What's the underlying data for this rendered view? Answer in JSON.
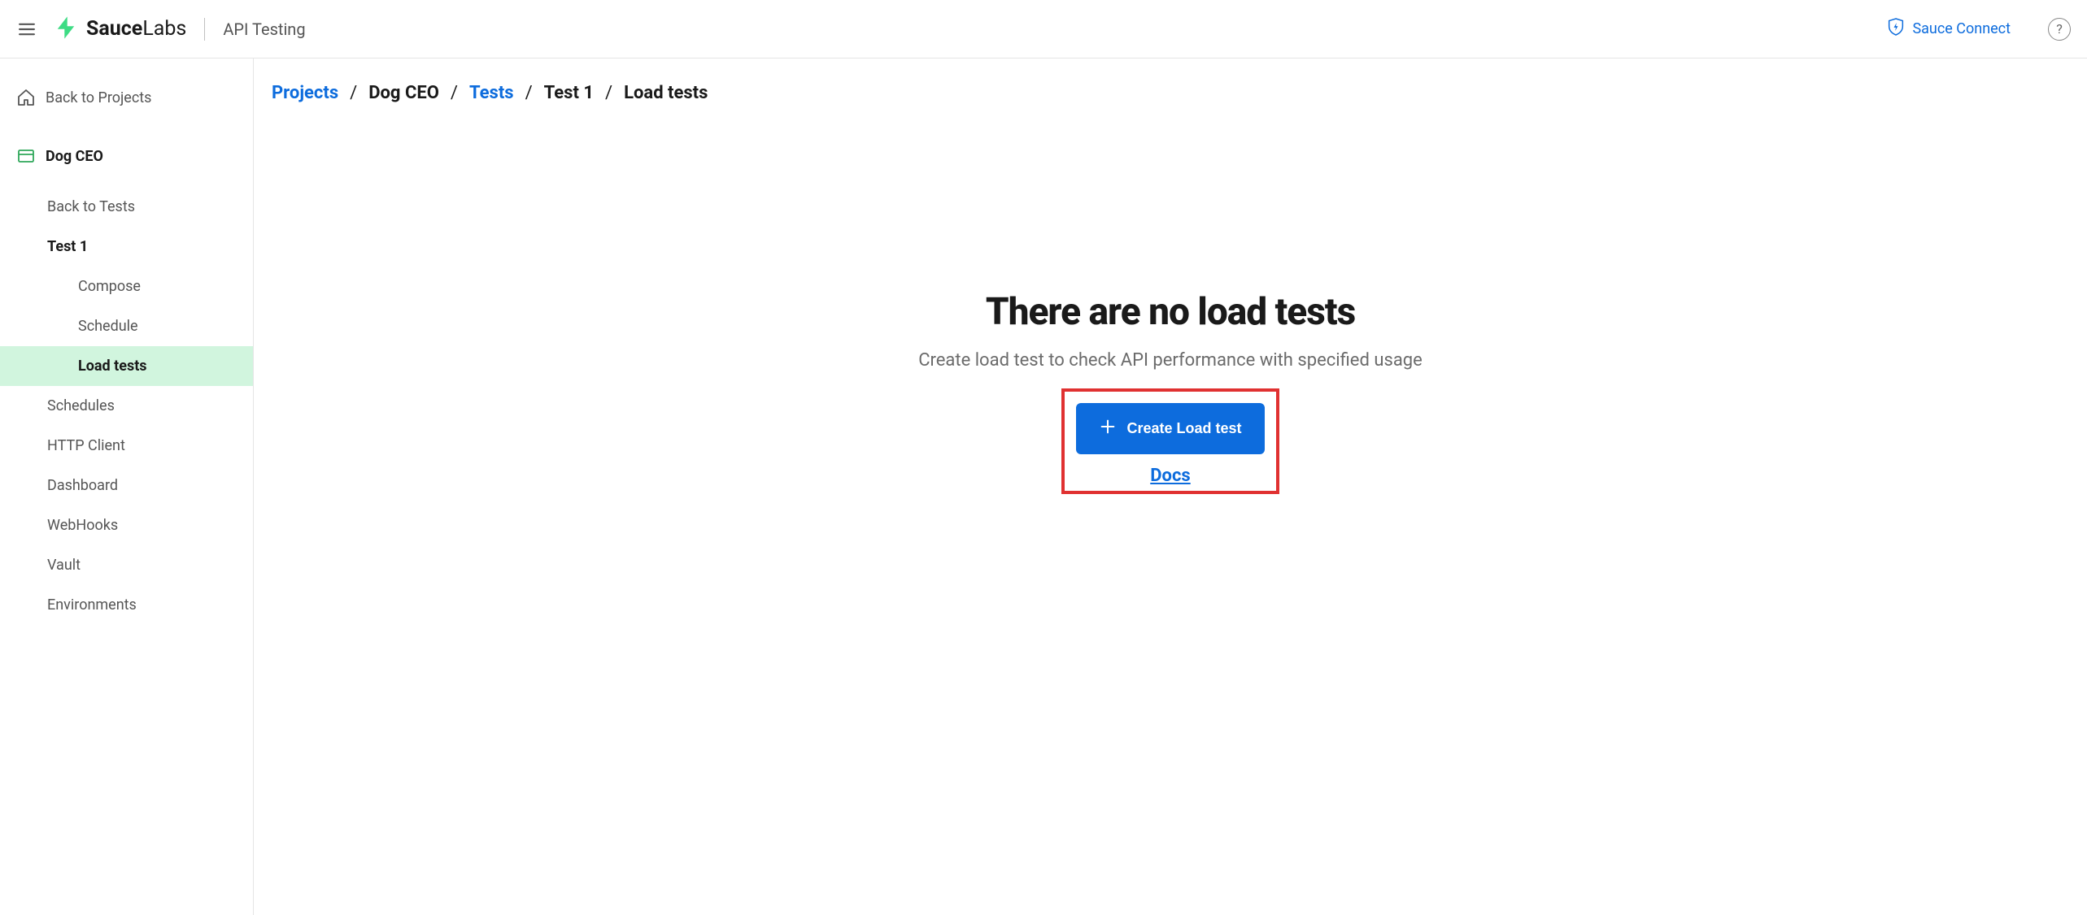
{
  "header": {
    "brand_part1": "Sauce",
    "brand_part2": "Labs",
    "app_name": "API Testing",
    "sauce_connect_label": "Sauce Connect",
    "help_glyph": "?"
  },
  "sidebar": {
    "back_to_projects": "Back to Projects",
    "project_name": "Dog CEO",
    "back_to_tests": "Back to Tests",
    "test_name": "Test 1",
    "sub_compose": "Compose",
    "sub_schedule": "Schedule",
    "sub_load_tests": "Load tests",
    "nav_schedules": "Schedules",
    "nav_http_client": "HTTP Client",
    "nav_dashboard": "Dashboard",
    "nav_webhooks": "WebHooks",
    "nav_vault": "Vault",
    "nav_environments": "Environments"
  },
  "breadcrumb": {
    "projects": "Projects",
    "project": "Dog CEO",
    "tests": "Tests",
    "test": "Test 1",
    "current": "Load tests",
    "sep": "/"
  },
  "main": {
    "empty_title": "There are no load tests",
    "empty_subtitle": "Create load test to check API performance with specified usage",
    "create_button": "Create Load test",
    "docs_link": "Docs"
  },
  "colors": {
    "accent_blue": "#0d6cdd",
    "brand_green": "#3ddc84",
    "highlight_red": "#e03131",
    "selected_bg": "#d1f5de"
  }
}
